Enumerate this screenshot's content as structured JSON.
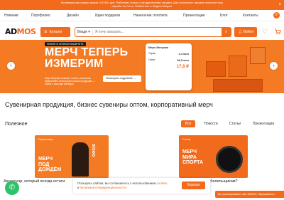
{
  "topbar": {
    "line1": "Минимальная сумма заказа 100 000 руб. Работаем только с юридическими лицами. Для розничных заказов посетите наш",
    "line2": "офлайн на Ozon, Wildberries и Яндекс.Маркет",
    "close": "×"
  },
  "menu": {
    "items": [
      "Новинки",
      "Портфолио",
      "Дизайн",
      "Идеи подарков",
      "Нанесение логотипа",
      "Презентации",
      "Блог",
      "Контакты"
    ],
    "phone_icon": "phone-icon"
  },
  "header": {
    "logo_a": "AD",
    "logo_b": "MOS",
    "catalog_label": "Каталог",
    "search_scope": "Везде",
    "search_placeholder": "Я хочу заказать...",
    "login_label": "Войти",
    "icons": [
      "heart-icon",
      "cart-icon"
    ]
  },
  "banner": {
    "tag": "НОВОЕ В ЛИЧНОМ КАБИНЕТЕ",
    "headline_1": "МЕРЧ ТЕПЕРЬ",
    "headline_2": "ИЗМЕРИМ",
    "desc": "Мерч-Метрика поможет понять, насколько эффективно используется ваша продукция — тираж и расходы наглядно",
    "button": "Посмотреть подробнее",
    "card_title": "Мерч-Метрика",
    "card_row1_label": "Тираж",
    "card_row1_value": "1,4 млн",
    "card_row2_label": "Охват",
    "card_row2_value": "28,5 млн",
    "card_price": "17,8 ₽",
    "prev": "‹",
    "next": "›"
  },
  "page_title": "Сувенирная продукция, бизнес сувениры оптом, корпоративный мерч",
  "useful": {
    "title": "Полезное",
    "tabs": [
      "Всё",
      "Новости",
      "Статьи",
      "Презентации"
    ],
    "active_tab": 0
  },
  "cards": [
    {
      "label": "Презентация",
      "big": "МЕРЧ ПОД ДОЖДЁМ",
      "brand": "sisoo"
    },
    {
      "label": "Статьи",
      "big": "МЕРЧ МИРА СПОРТА"
    }
  ],
  "captions": {
    "left": "Аксессуар, который всегда кстати",
    "right": "больше нужно болельщикам?"
  },
  "cookie": {
    "text": "Пользуясь сайтом, вы соглашаетесь с использованием",
    "link1": "cookies",
    "and": "и",
    "link2": "политикой конфиденциальности.",
    "button": "Хорошо"
  },
  "chat_icon": "phone-icon",
  "notice": "Вы просматриваете сайт ADMOS, Обращайтесь!",
  "colors": {
    "accent": "#f26a1b",
    "accent_light": "#f47a23",
    "chat": "#2ec36a"
  }
}
